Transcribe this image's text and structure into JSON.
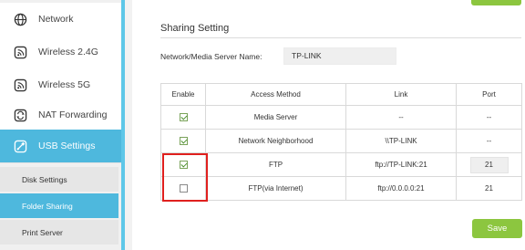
{
  "sidebar": {
    "items": [
      {
        "label": "Network",
        "icon": "globe-icon"
      },
      {
        "label": "Wireless 2.4G",
        "icon": "wireless-icon"
      },
      {
        "label": "Wireless 5G",
        "icon": "wireless-icon"
      },
      {
        "label": "NAT Forwarding",
        "icon": "nat-icon"
      },
      {
        "label": "USB Settings",
        "icon": "usb-icon",
        "active": true
      }
    ],
    "subitems": [
      {
        "label": "Disk Settings"
      },
      {
        "label": "Folder Sharing",
        "active": true
      },
      {
        "label": "Print Server"
      }
    ],
    "accent_color": "#4eb8dd"
  },
  "sharing": {
    "title": "Sharing Setting",
    "server_name_label": "Network/Media Server Name:",
    "server_name_value": "TP-LINK"
  },
  "table": {
    "headers": [
      "Enable",
      "Access Method",
      "Link",
      "Port"
    ],
    "rows": [
      {
        "enabled": true,
        "method": "Media Server",
        "link": "--",
        "port": "--"
      },
      {
        "enabled": true,
        "method": "Network Neighborhood",
        "link": "\\\\TP-LINK",
        "port": "--"
      },
      {
        "enabled": true,
        "method": "FTP",
        "link": "ftp://TP-LINK:21",
        "port": "21"
      },
      {
        "enabled": false,
        "method": "FTP(via Internet)",
        "link": "ftp://0.0.0.0:21",
        "port": "21"
      }
    ]
  },
  "save_label": "Save",
  "save_color": "#8cc63f",
  "highlight_color": "#e0201e"
}
